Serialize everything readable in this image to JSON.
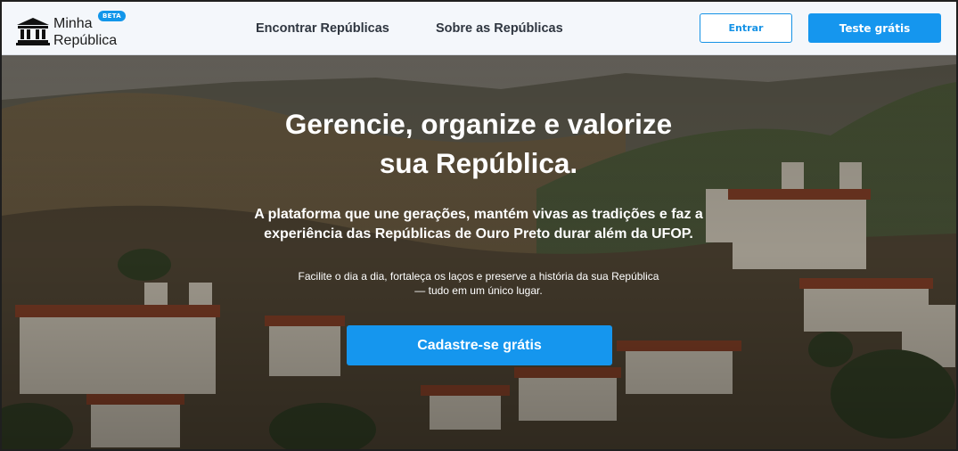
{
  "header": {
    "logo": {
      "line1": "Minha",
      "line2": "República",
      "badge": "BETA",
      "icon": "institution-building-icon"
    },
    "nav": [
      {
        "label": "Encontrar Repúblicas"
      },
      {
        "label": "Sobre as Repúblicas"
      }
    ],
    "login_label": "Entrar",
    "trial_label": "Teste grátis"
  },
  "hero": {
    "title_line1": "Gerencie, organize e valorize",
    "title_line2": "sua República.",
    "subtitle_line1": "A plataforma que une gerações, mantém vivas as tradições e faz a",
    "subtitle_line2": "experiência das Repúblicas de Ouro Preto durar além da UFOP.",
    "small_line1": "Facilite o dia a dia, fortaleça os laços e preserve a história da sua República",
    "small_line2": "— tudo em um único lugar.",
    "cta_label": "Cadastre-se grátis"
  },
  "colors": {
    "accent": "#1596ee",
    "header_bg": "#f4f7fb",
    "text_dark": "#2f3640"
  }
}
